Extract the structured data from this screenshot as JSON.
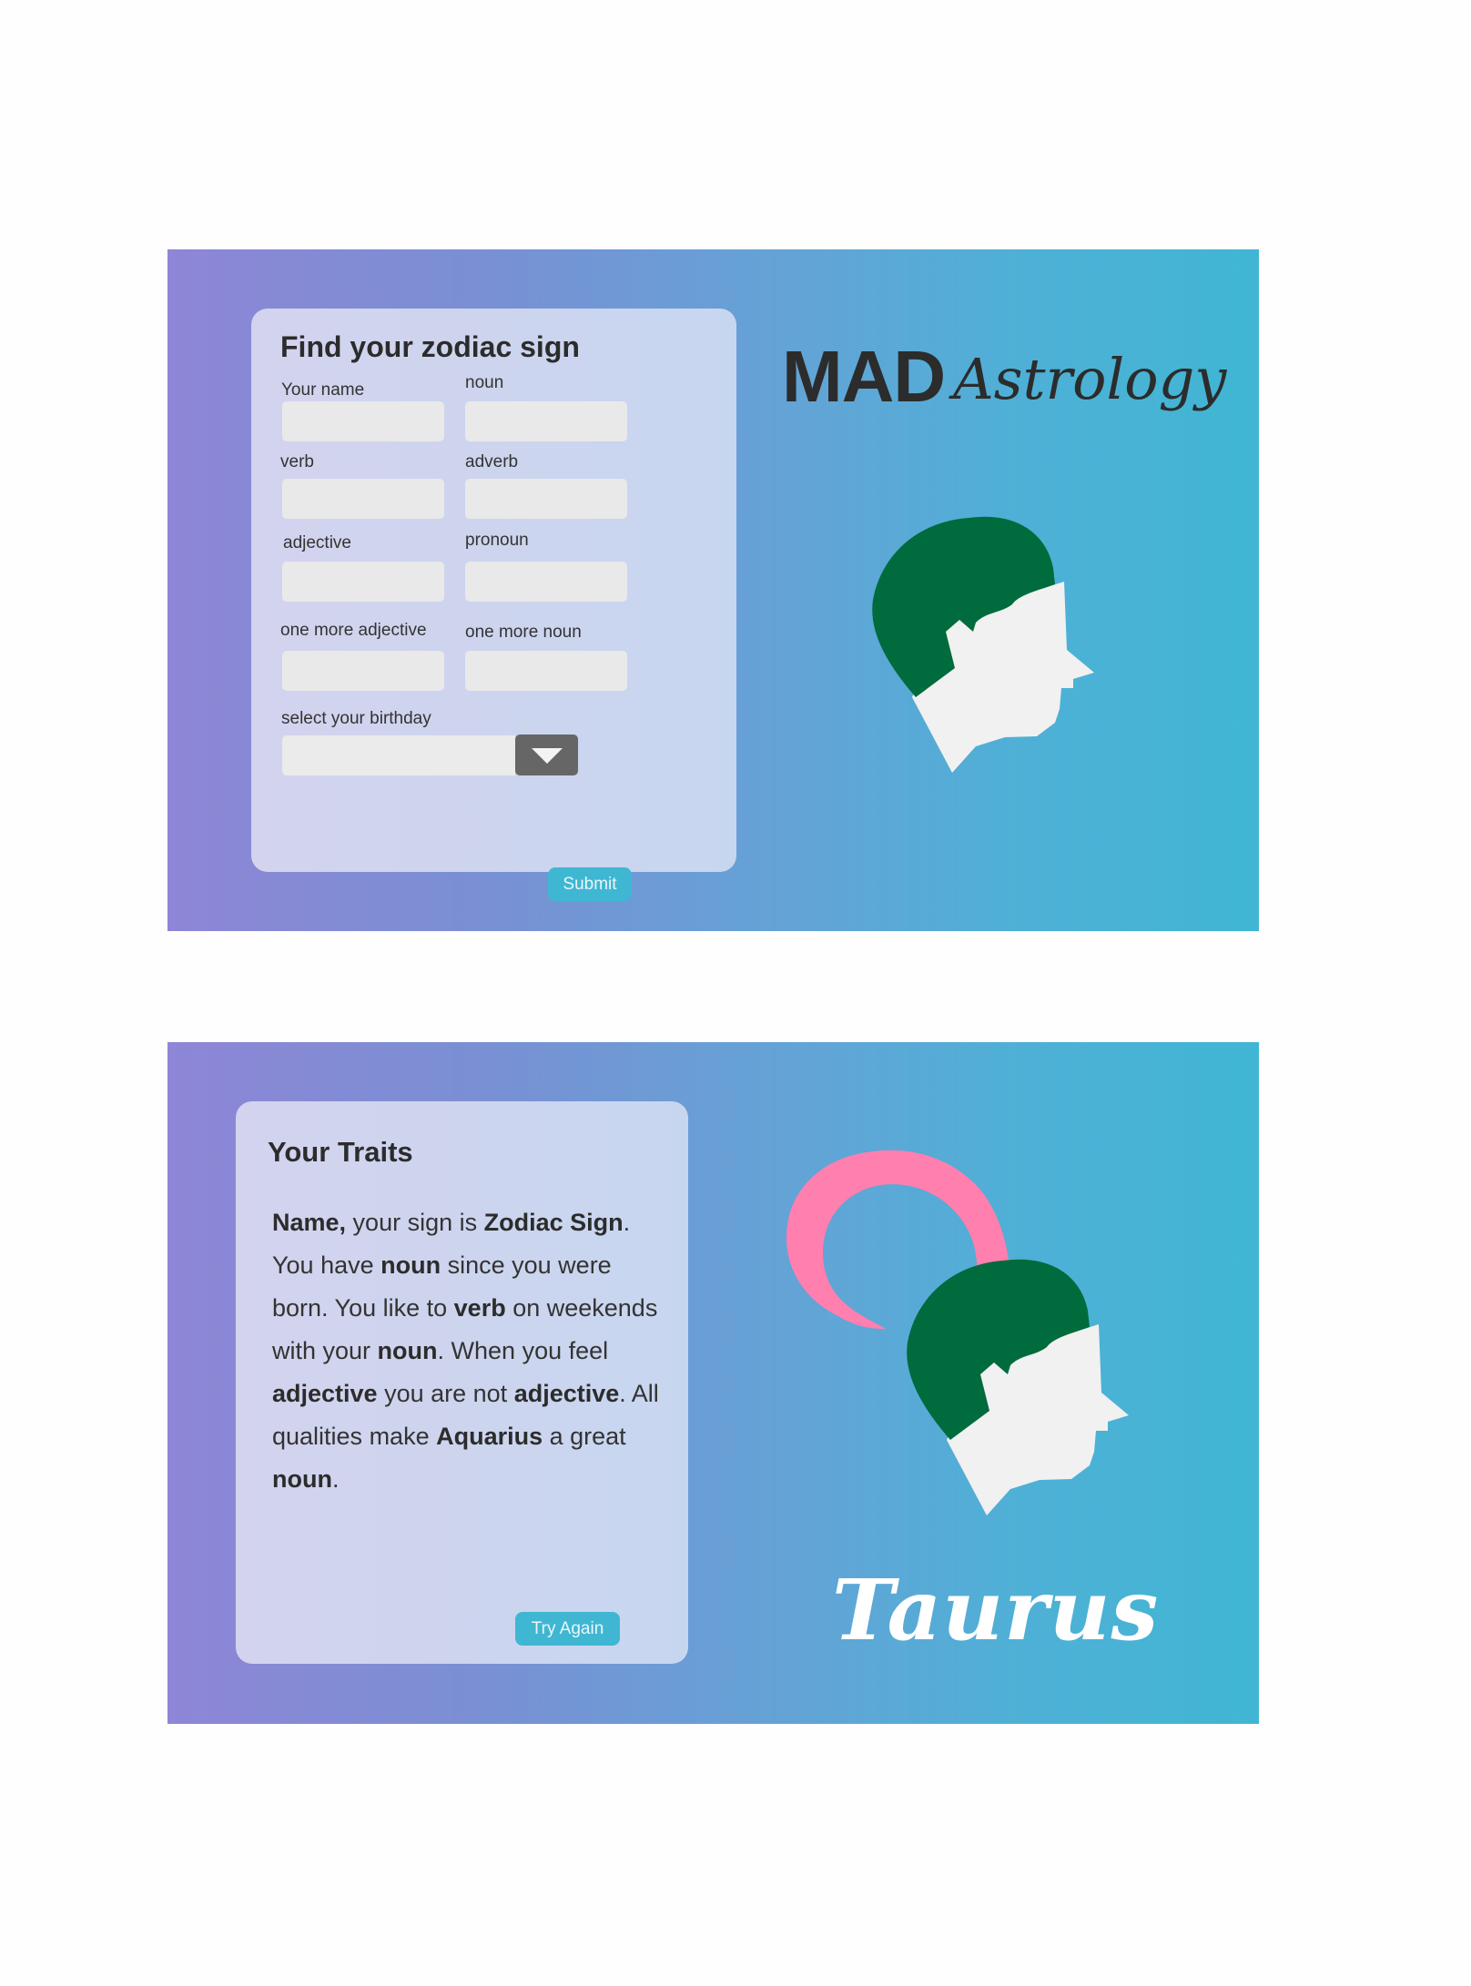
{
  "form": {
    "title": "Find your zodiac sign",
    "fields": {
      "name": {
        "label": "Your name",
        "value": ""
      },
      "noun": {
        "label": "noun",
        "value": ""
      },
      "verb": {
        "label": "verb",
        "value": ""
      },
      "adverb": {
        "label": "adverb",
        "value": ""
      },
      "adjective": {
        "label": "adjective",
        "value": ""
      },
      "pronoun": {
        "label": "pronoun",
        "value": ""
      },
      "more_adjective": {
        "label": "one more adjective",
        "value": ""
      },
      "more_noun": {
        "label": "one more noun",
        "value": ""
      }
    },
    "birthday": {
      "label": "select your birthday",
      "value": ""
    },
    "submit_label": "Submit"
  },
  "logo": {
    "mad": "MAD",
    "astrology": "Astrology"
  },
  "result": {
    "title": "Your Traits",
    "text": {
      "s1": "Name,",
      "s2": " your sign is ",
      "s3": "Zodiac Sign",
      "s4": ". You have ",
      "s5": "noun",
      "s6": " since you were born. You like to ",
      "s7": "verb",
      "s8": " on weekends with your ",
      "s9": "noun",
      "s10": ". When you feel ",
      "s11": "adjective",
      "s12": " you are not ",
      "s13": "adjective",
      "s14": ". All qualities make ",
      "s15": "Aquarius",
      "s16": " a great ",
      "s17": "noun",
      "s18": "."
    },
    "try_again_label": "Try Again",
    "sign": "Taurus"
  },
  "colors": {
    "gradient_start": "#8e86d6",
    "gradient_end": "#40b6d4",
    "button": "#3fb7d2",
    "hair": "#006b3c",
    "face": "#f1f1f1",
    "horn": "#ff7fae"
  },
  "icons": {
    "dropdown": "chevron-down-icon",
    "head": "head-profile-illustration",
    "horn": "horn-illustration"
  }
}
